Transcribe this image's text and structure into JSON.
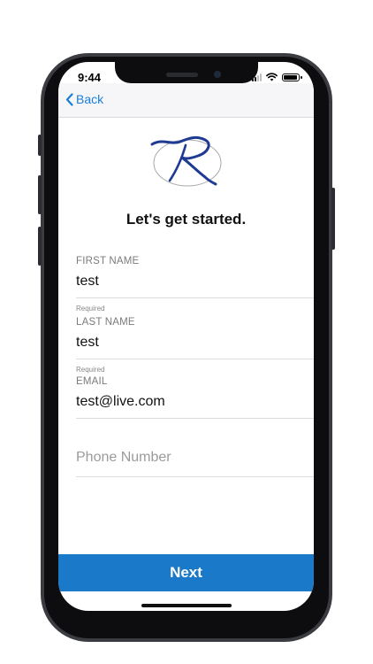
{
  "status_bar": {
    "time": "9:44"
  },
  "nav": {
    "back_label": "Back"
  },
  "header": {
    "title": "Let's get started."
  },
  "form": {
    "first_name": {
      "label": "FIRST NAME",
      "value": "test",
      "helper": "Required"
    },
    "last_name": {
      "label": "LAST NAME",
      "value": "test",
      "helper": "Required"
    },
    "email": {
      "label": "EMAIL",
      "value": "test@live.com"
    },
    "phone": {
      "placeholder": "Phone Number",
      "value": ""
    }
  },
  "actions": {
    "next_label": "Next"
  },
  "colors": {
    "accent": "#1a79c9",
    "link": "#1a7ed8",
    "logo": "#1f3a93"
  },
  "icons": {
    "back": "chevron-left-icon",
    "signal": "cellular-signal-icon",
    "wifi": "wifi-icon",
    "battery": "battery-icon"
  }
}
